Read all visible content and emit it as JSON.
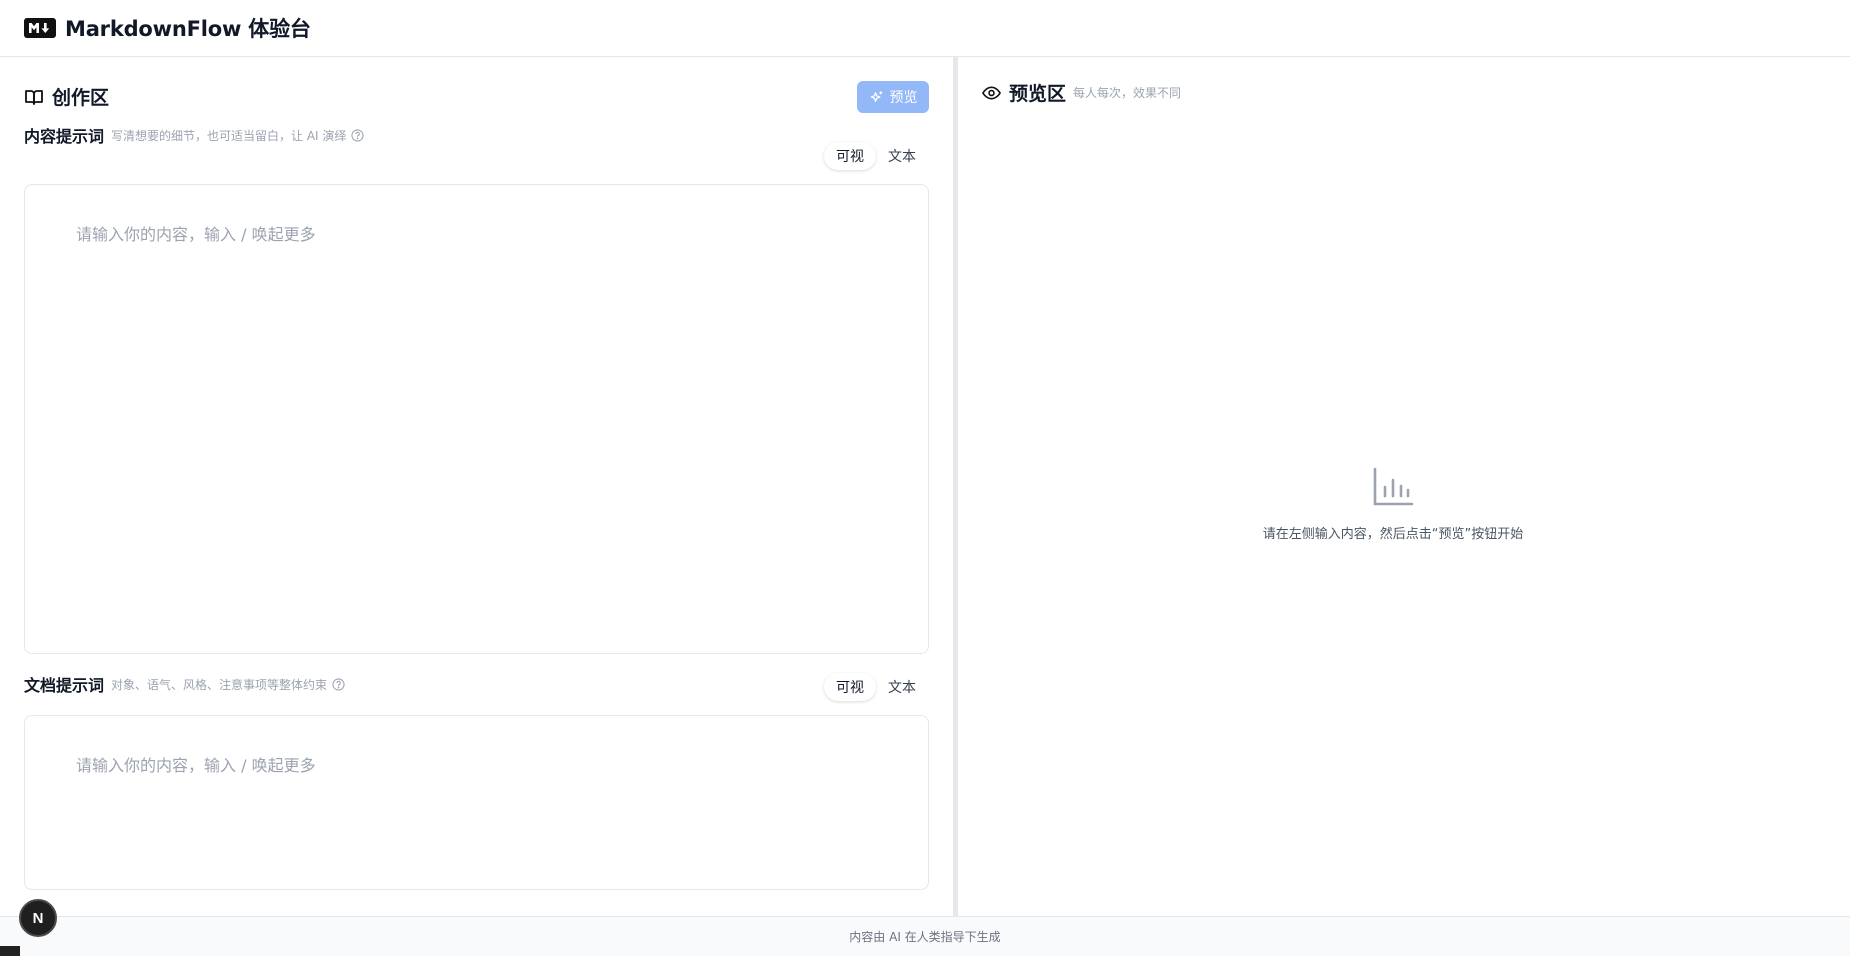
{
  "app": {
    "title": "MarkdownFlow 体验台"
  },
  "left_panel": {
    "title": "创作区",
    "preview_button_label": "预览",
    "content_prompt": {
      "label": "内容提示词",
      "hint": "写清想要的细节，也可适当留白，让 AI 演绎",
      "toggle": {
        "visual": "可视",
        "text": "文本",
        "active": "visual"
      },
      "placeholder": "请输入你的内容，输入 / 唤起更多"
    },
    "document_prompt": {
      "label": "文档提示词",
      "hint": "对象、语气、风格、注意事项等整体约束",
      "toggle": {
        "visual": "可视",
        "text": "文本",
        "active": "visual"
      },
      "placeholder": "请输入你的内容，输入 / 唤起更多"
    }
  },
  "right_panel": {
    "title": "预览区",
    "subtitle": "每人每次，效果不同",
    "empty_state": "请在左侧输入内容，然后点击“预览”按钮开始"
  },
  "footer": {
    "text": "内容由 AI 在人类指导下生成"
  },
  "badge": {
    "letter": "N"
  },
  "colors": {
    "accent_disabled": "#93b8f7",
    "border": "#e5e7eb",
    "muted_text": "#9ca3af"
  }
}
